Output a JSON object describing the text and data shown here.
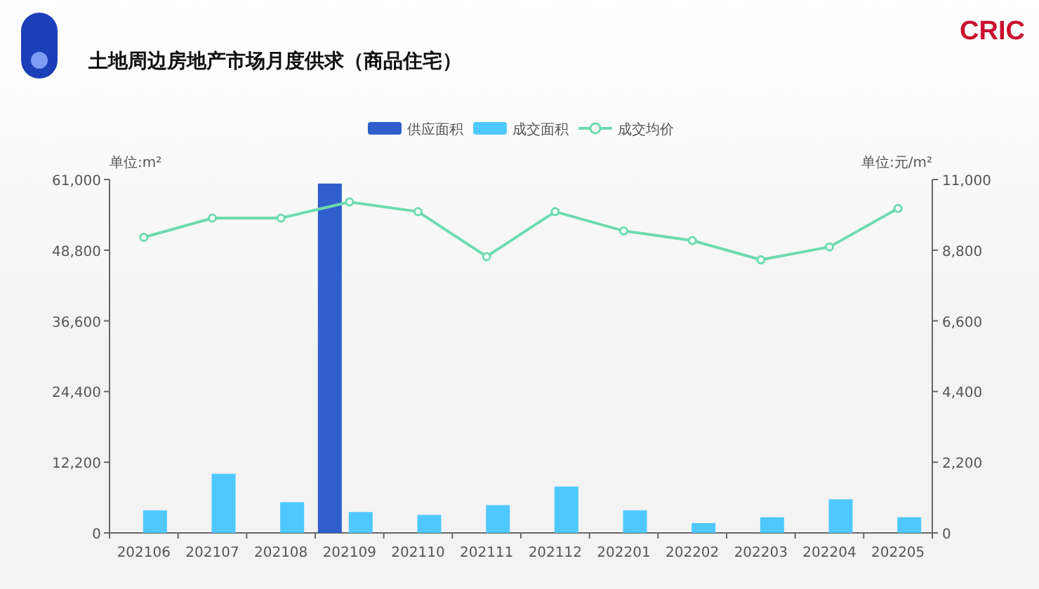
{
  "header": {
    "title": "土地周边房地产市场月度供求（商品住宅）",
    "logo": "CRIC"
  },
  "chart": {
    "chart_data": {
      "type": "bar",
      "categories": [
        "202106",
        "202107",
        "202108",
        "202109",
        "202110",
        "202111",
        "202112",
        "202201",
        "202202",
        "202203",
        "202204",
        "202205"
      ],
      "series": [
        {
          "name": "供应面积",
          "color": "#2f5fcc",
          "values": [
            0,
            0,
            0,
            60300,
            0,
            0,
            0,
            0,
            0,
            0,
            0,
            0
          ]
        },
        {
          "name": "成交面积",
          "color": "#4fc8ff",
          "values": [
            3900,
            10200,
            5300,
            3600,
            3100,
            4800,
            8000,
            3900,
            1700,
            2700,
            5800,
            2700
          ]
        },
        {
          "name": "成交均价",
          "color": "#6ddbb0",
          "type": "line",
          "axis": "y2",
          "marker": "circle",
          "values": [
            9200,
            9800,
            9800,
            10300,
            10000,
            8600,
            10000,
            9400,
            9100,
            8500,
            8900,
            10100
          ]
        }
      ],
      "legend": "top",
      "ylabel": "单位:m²",
      "y2label": "单位:元/m²",
      "ylim": [
        0,
        61000
      ],
      "y2lim": [
        0,
        11000
      ],
      "yticks": [
        {
          "value": 0,
          "label": "0"
        },
        {
          "value": 12200,
          "label": "12,200"
        },
        {
          "value": 24400,
          "label": "24,400"
        },
        {
          "value": 36600,
          "label": "36,600"
        },
        {
          "value": 48800,
          "label": "48,800"
        },
        {
          "value": 61000,
          "label": "61,000"
        }
      ],
      "y2ticks": [
        {
          "value": 0,
          "label": "0"
        },
        {
          "value": 2200,
          "label": "2,200"
        },
        {
          "value": 4400,
          "label": "4,400"
        },
        {
          "value": 6600,
          "label": "6,600"
        },
        {
          "value": 8800,
          "label": "8,800"
        },
        {
          "value": 11000,
          "label": "11,000"
        }
      ]
    }
  }
}
